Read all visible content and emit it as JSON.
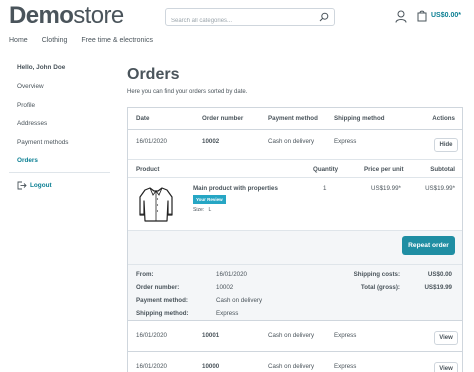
{
  "header": {
    "logo_bold": "Demo",
    "logo_rest": "store",
    "search_placeholder": "Search all categories...",
    "cart_total": "US$0.00*"
  },
  "nav": [
    "Home",
    "Clothing",
    "Free time & electronics"
  ],
  "sidebar": {
    "greeting": "Hello, John Doe",
    "items": [
      {
        "label": "Overview"
      },
      {
        "label": "Profile"
      },
      {
        "label": "Addresses"
      },
      {
        "label": "Payment methods"
      },
      {
        "label": "Orders",
        "active": true
      }
    ],
    "logout": "Logout"
  },
  "main": {
    "title": "Orders",
    "subtitle": "Here you can find your orders sorted by date."
  },
  "table": {
    "columns": [
      "Date",
      "Order number",
      "Payment method",
      "Shipping method",
      "Actions"
    ],
    "orders": [
      {
        "date": "16/01/2020",
        "number": "10002",
        "payment": "Cash on delivery",
        "shipping": "Express",
        "action": "Hide"
      },
      {
        "date": "16/01/2020",
        "number": "10001",
        "payment": "Cash on delivery",
        "shipping": "Express",
        "action": "View"
      },
      {
        "date": "16/01/2020",
        "number": "10000",
        "payment": "Cash on delivery",
        "shipping": "Express",
        "action": "View"
      }
    ]
  },
  "detail": {
    "columns": [
      "Product",
      "Quantity",
      "Price per unit",
      "Subtotal"
    ],
    "product": {
      "name": "Main product with properties",
      "badge": "Your Review",
      "size_label": "Size:",
      "size_value": "L",
      "quantity": "1",
      "unit_price": "US$19.99*",
      "subtotal": "US$19.99*"
    },
    "reorder_label": "Repeat order",
    "summary": {
      "from_label": "From:",
      "from_value": "16/01/2020",
      "number_label": "Order number:",
      "number_value": "10002",
      "payment_label": "Payment method:",
      "payment_value": "Cash on delivery",
      "shipping_label": "Shipping method:",
      "shipping_value": "Express",
      "shipping_costs_label": "Shipping costs:",
      "shipping_costs_value": "US$0.00",
      "total_label": "Total (gross):",
      "total_value": "US$19.99"
    }
  },
  "colors": {
    "accent": "#0b7f93",
    "button": "#1f8ea3",
    "badge": "#26a6c4"
  }
}
